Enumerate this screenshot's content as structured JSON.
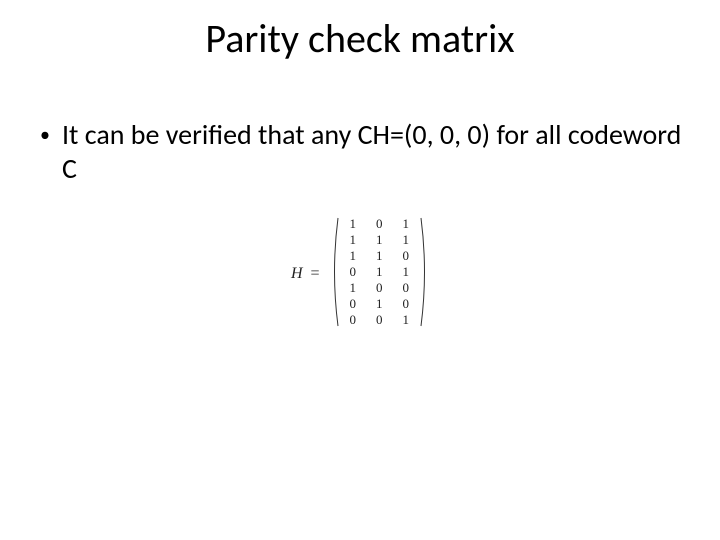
{
  "title": "Parity check matrix",
  "bullet": {
    "marker": "•",
    "text": "It can be verified that any CH=(0, 0, 0) for all codeword C"
  },
  "matrix": {
    "label": "H",
    "eq": "=",
    "rows": [
      [
        "1",
        "0",
        "1"
      ],
      [
        "1",
        "1",
        "1"
      ],
      [
        "1",
        "1",
        "0"
      ],
      [
        "0",
        "1",
        "1"
      ],
      [
        "1",
        "0",
        "0"
      ],
      [
        "0",
        "1",
        "0"
      ],
      [
        "0",
        "0",
        "1"
      ]
    ]
  }
}
